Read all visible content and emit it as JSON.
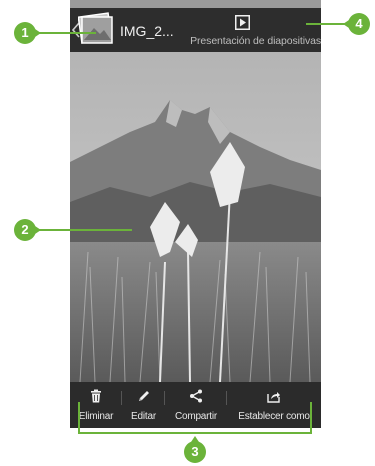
{
  "header": {
    "file_name": "IMG_2...",
    "slideshow_label": "Presentación de diapositivas",
    "play_icon": "play-icon",
    "thumbnail_icon": "photo-stack-icon"
  },
  "actions": [
    {
      "label": "Eliminar",
      "icon": "trash-icon"
    },
    {
      "label": "Editar",
      "icon": "pencil-icon"
    },
    {
      "label": "Compartir",
      "icon": "share-icon"
    },
    {
      "label": "Establecer como",
      "icon": "set-as-icon"
    }
  ],
  "callouts": [
    "1",
    "2",
    "3",
    "4"
  ],
  "colors": {
    "callout_green": "#6bb33a",
    "bar_background": "#2d2d2d"
  }
}
